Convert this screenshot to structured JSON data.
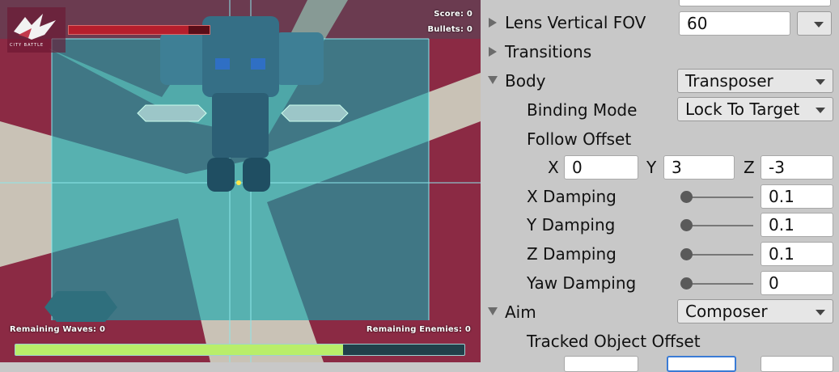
{
  "game": {
    "score_label": "Score: 0",
    "bullets_label": "Bullets: 0",
    "logo_text": "CITY BATTLE",
    "remaining_waves_label": "Remaining Waves: 0",
    "remaining_enemies_label": "Remaining Enemies: 0",
    "health_fraction": 0.85,
    "progress_fraction": 0.73,
    "colors": {
      "hud_text": "#ffffff",
      "frame": "#7e1d3e",
      "overlay": "#0fa5a8",
      "progress_fill": "#b9ee6a",
      "health_fill": "#b51e2c"
    }
  },
  "inspector": {
    "lens_vertical_fov": {
      "label": "Lens Vertical FOV",
      "value": "60"
    },
    "transitions": {
      "label": "Transitions"
    },
    "body": {
      "label": "Body",
      "value": "Transposer"
    },
    "binding_mode": {
      "label": "Binding Mode",
      "value": "Lock To Target"
    },
    "follow_offset": {
      "label": "Follow Offset",
      "x_label": "X",
      "x_value": "0",
      "y_label": "Y",
      "y_value": "3",
      "z_label": "Z",
      "z_value": "-3"
    },
    "x_damping": {
      "label": "X Damping",
      "value": "0.1"
    },
    "y_damping": {
      "label": "Y Damping",
      "value": "0.1"
    },
    "z_damping": {
      "label": "Z Damping",
      "value": "0.1"
    },
    "yaw_damping": {
      "label": "Yaw Damping",
      "value": "0"
    },
    "aim": {
      "label": "Aim",
      "value": "Composer"
    },
    "tracked_object_offset": {
      "label": "Tracked Object Offset"
    }
  }
}
